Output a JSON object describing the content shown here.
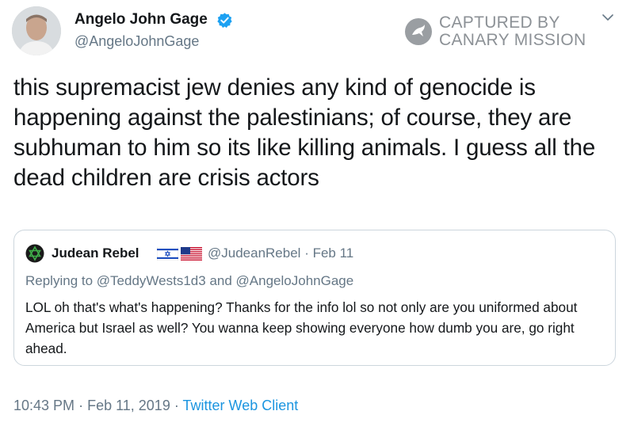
{
  "tweet": {
    "author": {
      "display_name": "Angelo John Gage",
      "handle": "@AngeloJohnGage",
      "verified": true,
      "avatar_icon": "profile-photo"
    },
    "text": "this supremacist jew denies any kind of genocide is happening against the palestinians; of course, they are subhuman to him so its like killing animals. I guess all the dead children are crisis actors",
    "timestamp": "10:43 PM",
    "separator": "·",
    "date": "Feb 11, 2019",
    "client": "Twitter Web Client"
  },
  "watermark": {
    "line1": "CAPTURED BY",
    "line2": "CANARY MISSION"
  },
  "quoted_tweet": {
    "author": {
      "display_name": "Judean Rebel",
      "handle": "@JudeanRebel",
      "flags": [
        "israel-flag-icon",
        "us-flag-icon"
      ]
    },
    "date_label": "· Feb 11",
    "replying_prefix": "Replying to",
    "reply_to_1": "@TeddyWests1d3",
    "reply_joiner": "and",
    "reply_to_2": "@AngeloJohnGage",
    "text": "LOL oh that's what's happening? Thanks for the info lol so not only are you uniformed about America but Israel as well? You wanna keep showing everyone how dumb you are, go right ahead."
  },
  "colors": {
    "text": "#14171a",
    "secondary": "#657786",
    "link": "#1b95e0",
    "verified": "#1da1f2",
    "border": "#ccd6dd"
  }
}
